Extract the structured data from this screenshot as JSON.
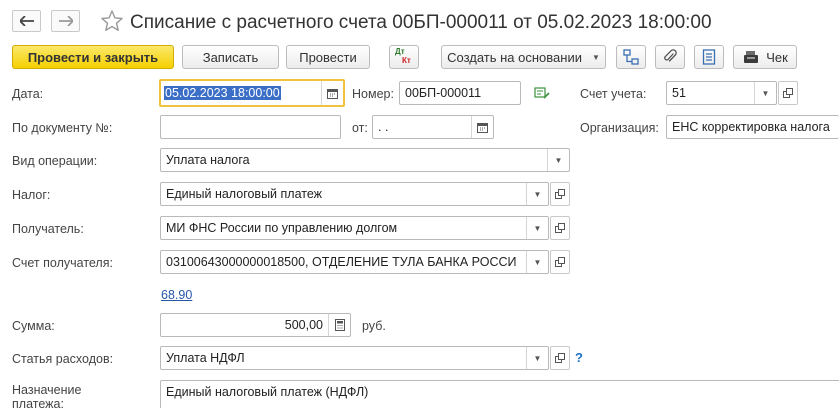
{
  "header": {
    "title": "Списание с расчетного счета 00БП-000011 от 05.02.2023 18:00:00"
  },
  "toolbar": {
    "post_close_label": "Провести и закрыть",
    "save_label": "Записать",
    "post_label": "Провести",
    "dt_label": "Дт",
    "kt_label": "Кт",
    "create_based_label": "Создать на основании",
    "receipt_label": "Чек"
  },
  "form": {
    "date": {
      "label": "Дата:",
      "value": "05.02.2023 18:00:00"
    },
    "number": {
      "label": "Номер:",
      "value": "00БП-000011"
    },
    "account": {
      "label": "Счет учета:",
      "value": "51"
    },
    "by_document": {
      "label": "По документу №:",
      "value": ""
    },
    "from": {
      "label": "от:",
      "value": " .  ."
    },
    "organization": {
      "label": "Организация:",
      "value": "ЕНС корректировка налога"
    },
    "operation_type": {
      "label": "Вид операции:",
      "value": "Уплата налога"
    },
    "tax": {
      "label": "Налог:",
      "value": "Единый налоговый платеж"
    },
    "recipient": {
      "label": "Получатель:",
      "value": "МИ ФНС России по управлению долгом"
    },
    "recipient_account": {
      "label": "Счет получателя:",
      "value": "03100643000000018500, ОТДЕЛЕНИЕ ТУЛА БАНКА РОССИ"
    },
    "account_link": "68.90",
    "amount": {
      "label": "Сумма:",
      "value": "500,00",
      "unit": "руб."
    },
    "expense_item": {
      "label": "Статья расходов:",
      "value": "Уплата НДФЛ",
      "help": "?"
    },
    "purpose": {
      "label": "Назначение платежа:",
      "value": "Единый налоговый платеж (НДФЛ)"
    }
  },
  "colors": {
    "primary_button": "#f5d000",
    "focus_border": "#f0c33c",
    "selection": "#3b6fc7",
    "link": "#2456a8"
  }
}
